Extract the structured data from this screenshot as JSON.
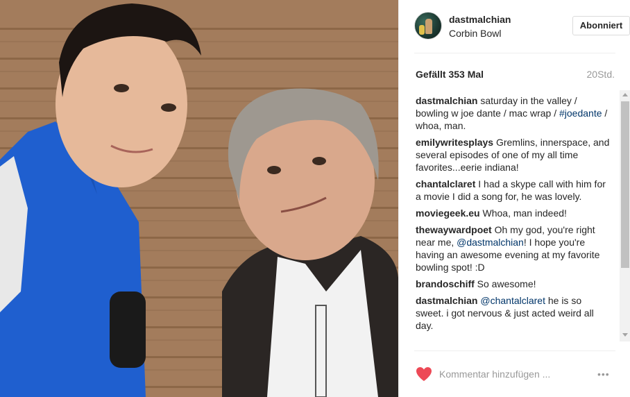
{
  "post": {
    "image_alt_icon": "photo",
    "username": "dastmalchian",
    "location": "Corbin Bowl",
    "follow_label": "Abonniert",
    "likes": "Gefällt 353 Mal",
    "time": "20Std."
  },
  "comments": [
    {
      "user": "dastmalchian",
      "parts": [
        {
          "t": " saturday in the valley / bowling w joe dante / mac wrap / "
        },
        {
          "t": "#joedante",
          "link": true
        },
        {
          "t": " / whoa, man."
        }
      ]
    },
    {
      "user": "emilywritesplays",
      "parts": [
        {
          "t": " Gremlins, innerspace, and several episodes of one of my all time favorites...eerie indiana!"
        }
      ]
    },
    {
      "user": "chantalclaret",
      "parts": [
        {
          "t": " I had a skype call with him for a movie I did a song for, he was lovely."
        }
      ]
    },
    {
      "user": "moviegeek.eu",
      "parts": [
        {
          "t": " Whoa, man indeed!"
        }
      ]
    },
    {
      "user": "thewaywardpoet",
      "parts": [
        {
          "t": " Oh my god, you're right near me, "
        },
        {
          "t": "@dastmalchian",
          "link": true
        },
        {
          "t": "! I hope you're having an awesome evening at my favorite bowling spot! :D"
        }
      ]
    },
    {
      "user": "brandoschiff",
      "parts": [
        {
          "t": " So awesome!"
        }
      ]
    },
    {
      "user": "dastmalchian",
      "parts": [
        {
          "t": " "
        },
        {
          "t": "@chantalclaret",
          "link": true
        },
        {
          "t": " he is so sweet. i got nervous & just acted weird all day."
        }
      ]
    }
  ],
  "footer": {
    "comment_placeholder": "Kommentar hinzufügen ...",
    "more_label": "•••",
    "heart_color": "#ed4956"
  }
}
